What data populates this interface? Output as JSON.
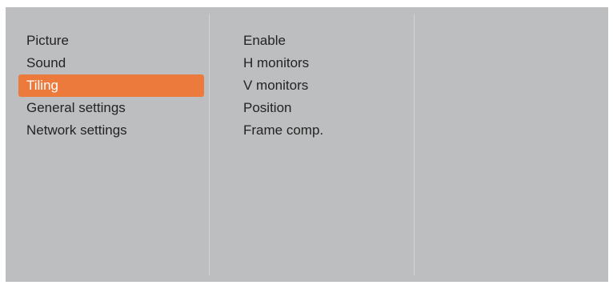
{
  "main_menu": {
    "items": [
      {
        "label": "Picture",
        "selected": false
      },
      {
        "label": "Sound",
        "selected": false
      },
      {
        "label": "Tiling",
        "selected": true
      },
      {
        "label": "General settings",
        "selected": false
      },
      {
        "label": "Network settings",
        "selected": false
      }
    ]
  },
  "submenu": {
    "items": [
      {
        "label": "Enable"
      },
      {
        "label": "H monitors"
      },
      {
        "label": "V monitors"
      },
      {
        "label": "Position"
      },
      {
        "label": "Frame comp."
      }
    ]
  },
  "colors": {
    "panel_background": "#bdbec0",
    "highlight": "#ec7a3c",
    "text": "#232323",
    "highlight_text": "#ffffff"
  }
}
